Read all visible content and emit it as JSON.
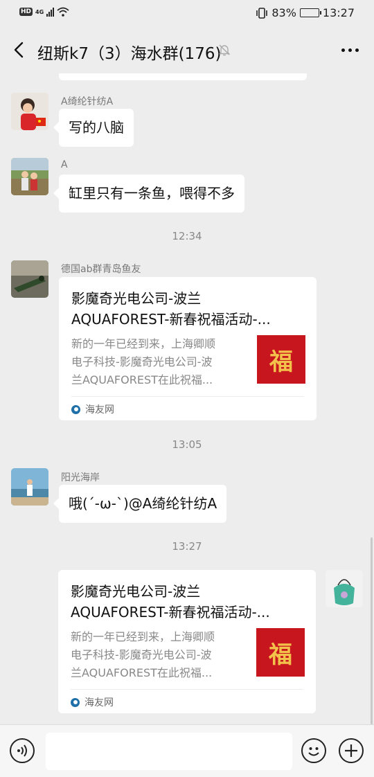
{
  "status": {
    "hd": "HD",
    "network": "4G",
    "battery_percent": "83%",
    "battery_level": 0.83,
    "time": "13:27"
  },
  "header": {
    "title": "纽斯k7（3）海水群(176)",
    "muted": true
  },
  "messages": {
    "m1": {
      "sender": "A绮纶针纺A",
      "text": "写的八脑"
    },
    "m2": {
      "sender": "A",
      "text": "缸里只有一条鱼，喂得不多"
    },
    "t1": "12:34",
    "m3": {
      "sender": "德国ab群青岛鱼友",
      "title_line1": "影魔奇光电公司-波兰",
      "title_line2": "AQUAFOREST-新春祝福活动-...",
      "desc_line1": "新的一年已经到来，上海卿顺",
      "desc_line2": "电子科技-影魔奇光电公司-波",
      "desc_line3": "兰AQUAFOREST在此祝福...",
      "thumb_char": "福",
      "source": "海友网"
    },
    "t2": "13:05",
    "m4": {
      "sender": "阳光海岸",
      "text": "哦(´-ω-`)@A绮纶针纺A"
    },
    "t3": "13:27",
    "m5": {
      "title_line1": "影魔奇光电公司-波兰",
      "title_line2": "AQUAFOREST-新春祝福活动-...",
      "desc_line1": "新的一年已经到来，上海卿顺",
      "desc_line2": "电子科技-影魔奇光电公司-波",
      "desc_line3": "兰AQUAFOREST在此祝福...",
      "thumb_char": "福",
      "source": "海友网"
    }
  },
  "input": {
    "placeholder": ""
  },
  "icons": {
    "back": "chevron-left-icon",
    "mute": "bell-off-icon",
    "more": "more-dots-icon",
    "voice": "voice-icon",
    "emoji": "emoji-icon",
    "plus": "plus-icon"
  },
  "colors": {
    "background": "#ededed",
    "bubble": "#ffffff",
    "thumb_red": "#c8161e",
    "thumb_gold": "#f3c24b"
  }
}
